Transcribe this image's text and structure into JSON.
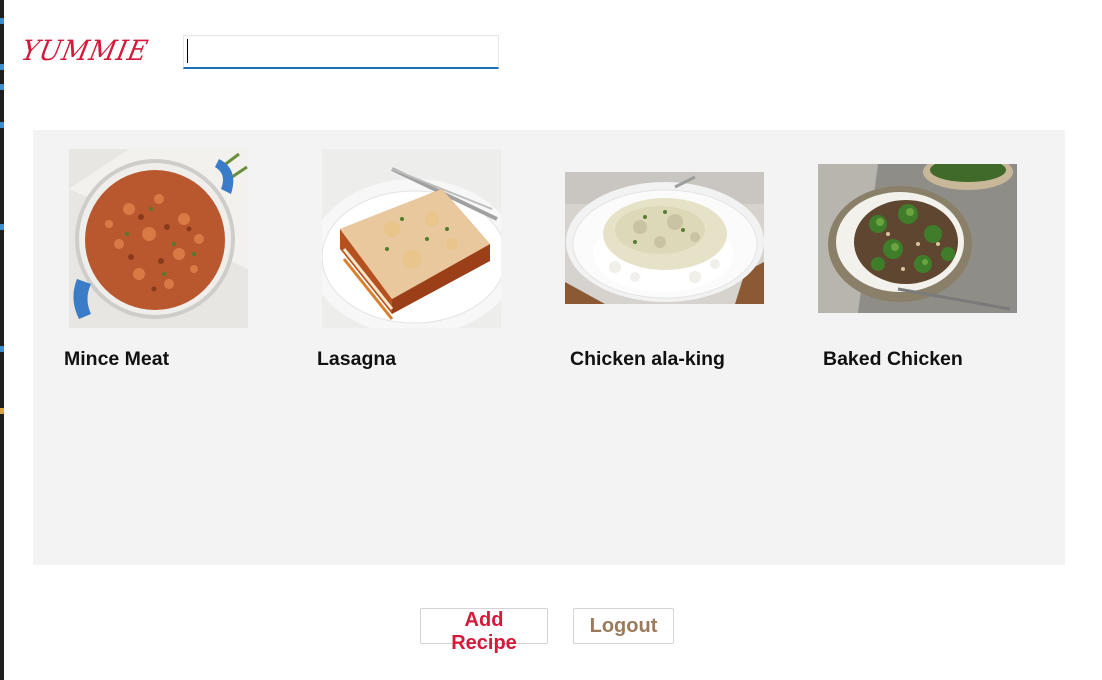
{
  "app": {
    "brand": "YUMMIE"
  },
  "search": {
    "value": "",
    "placeholder": ""
  },
  "recipes": [
    {
      "title": "Mince Meat",
      "image": "mince-meat-photo"
    },
    {
      "title": "Lasagna",
      "image": "lasagna-photo"
    },
    {
      "title": "Chicken ala-king",
      "image": "chicken-ala-king-photo"
    },
    {
      "title": "Baked Chicken",
      "image": "baked-chicken-photo"
    }
  ],
  "actions": {
    "add_recipe": "Add Recipe",
    "logout": "Logout"
  },
  "colors": {
    "brand": "#d4193a",
    "logout": "#9b7b5b",
    "panel": "#f3f3f3",
    "input_focus": "#1a6fb7"
  }
}
